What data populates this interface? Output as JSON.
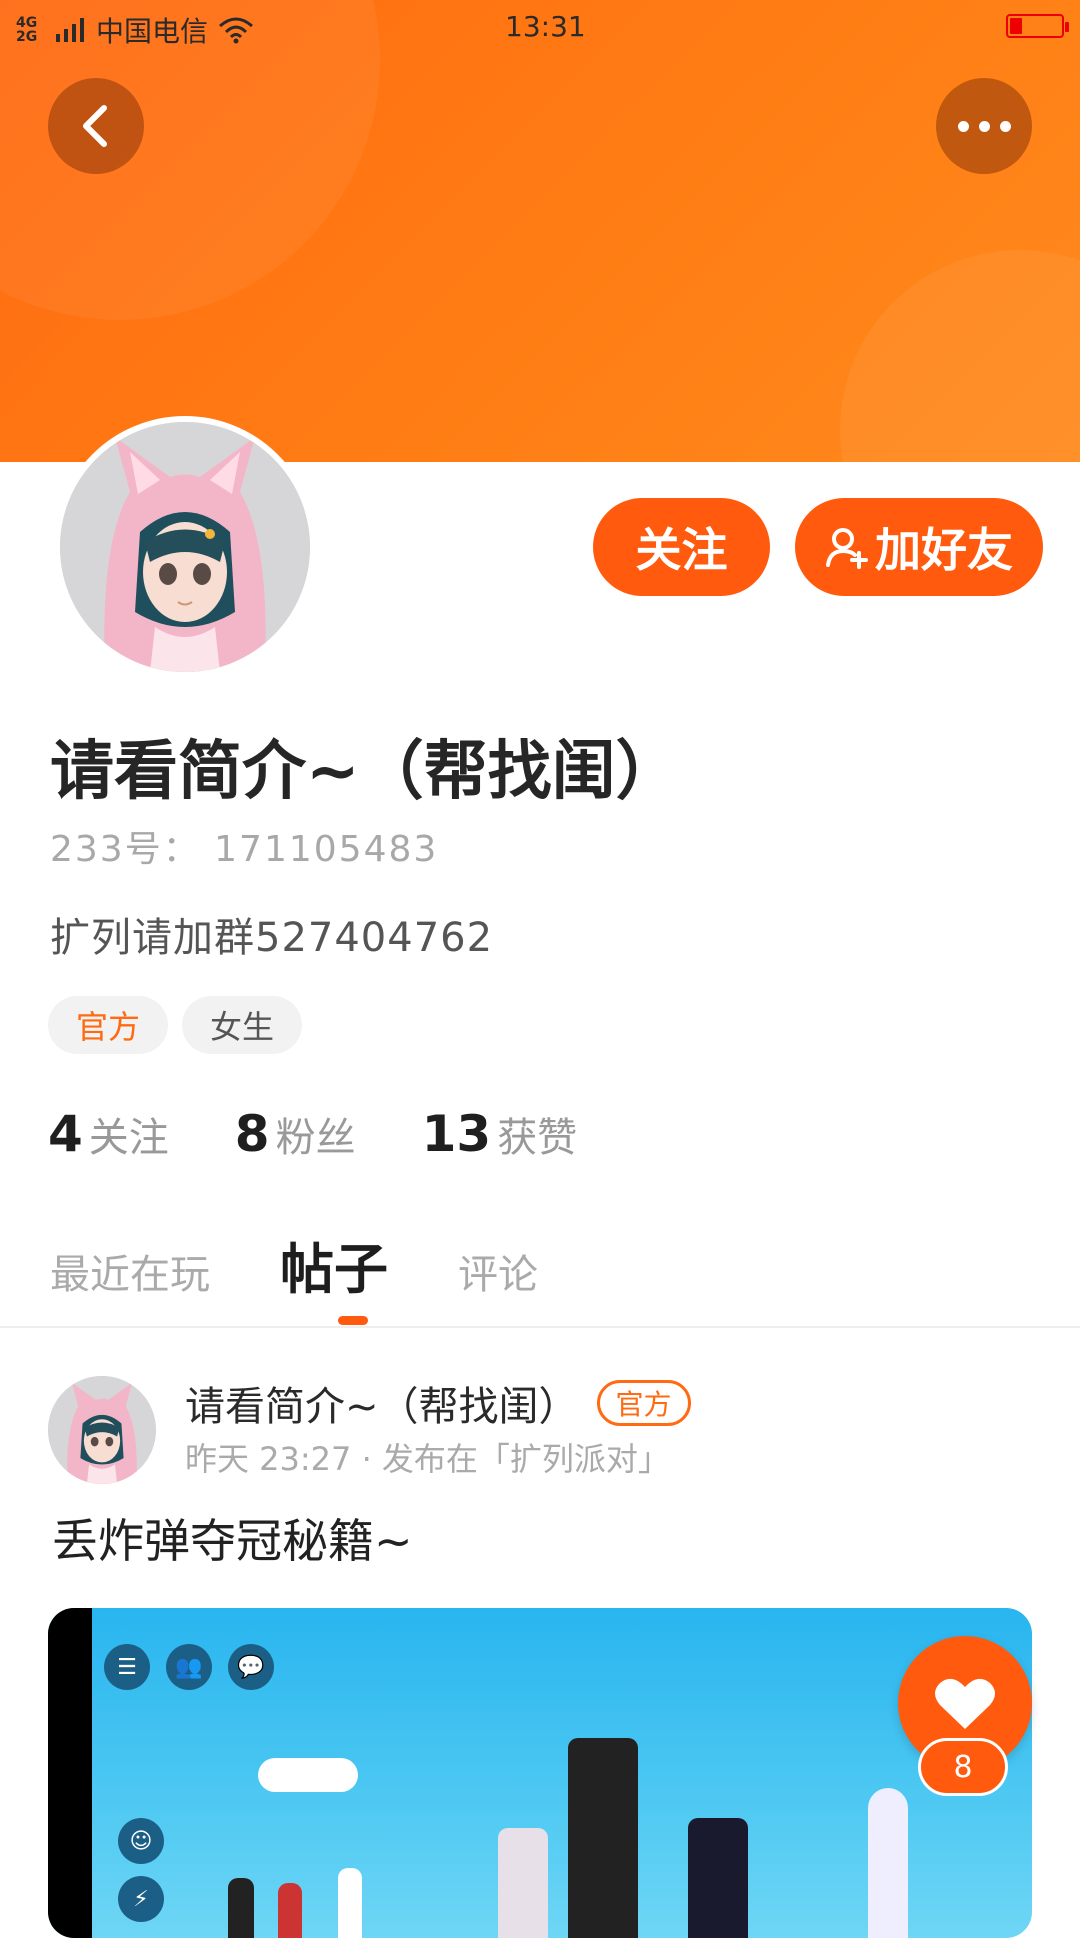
{
  "status_bar": {
    "network": "4G 2G",
    "carrier": "中国电信",
    "time": "13:31"
  },
  "profile": {
    "name": "请看简介~（帮找闺）",
    "uid": "233号： 171105483",
    "bio": "扩列请加群527404762",
    "tags": [
      "官方",
      "女生"
    ],
    "follow_label": "关注",
    "add_friend_label": "加好友",
    "stats": [
      {
        "count": "4",
        "label": "关注"
      },
      {
        "count": "8",
        "label": "粉丝"
      },
      {
        "count": "13",
        "label": "获赞"
      }
    ]
  },
  "tabs": [
    {
      "label": "最近在玩",
      "active": false
    },
    {
      "label": "帖子",
      "active": true
    },
    {
      "label": "评论",
      "active": false
    }
  ],
  "post": {
    "author": "请看简介~（帮找闺）",
    "badge": "官方",
    "meta": "昨天 23:27 · 发布在「扩列派对」",
    "title": "丢炸弹夺冠秘籍~",
    "like_count": "8"
  },
  "colors": {
    "accent": "#ff5a0d",
    "header_gradient_start": "#ff6a12",
    "header_gradient_end": "#ff8a1d"
  },
  "icons": {
    "back": "chevron-left-icon",
    "more": "more-dots-icon",
    "add_friend": "person-add-icon",
    "like": "heart-icon"
  }
}
